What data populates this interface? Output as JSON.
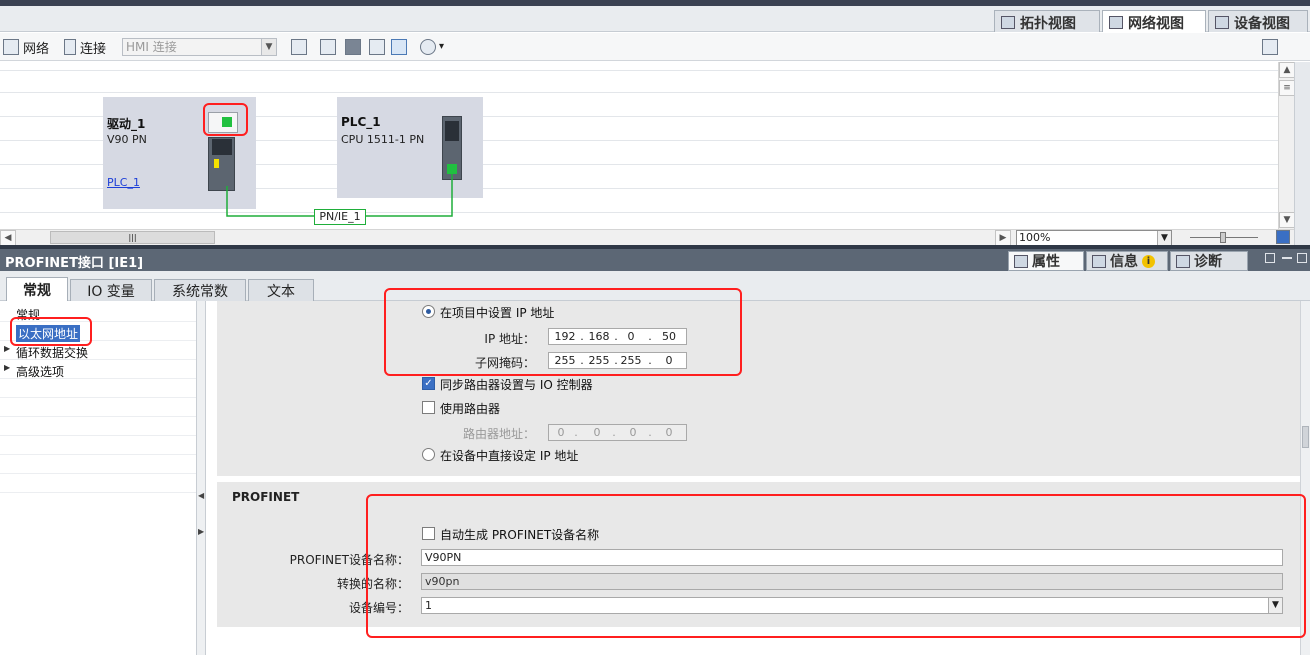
{
  "view_tabs": [
    {
      "label": "拓扑视图",
      "icon": "topology-view-icon"
    },
    {
      "label": "网络视图",
      "icon": "network-view-icon"
    },
    {
      "label": "设备视图",
      "icon": "device-view-icon"
    }
  ],
  "toolbar": {
    "network_label": "网络",
    "connect_label": "连接",
    "connection_type_value": "HMI 连接"
  },
  "canvas": {
    "devices": [
      {
        "name": "驱动_1",
        "type": "V90 PN",
        "assigned_plc": "PLC_1"
      },
      {
        "name": "PLC_1",
        "type": "CPU 1511-1 PN"
      }
    ],
    "subnet_label": "PN/IE_1",
    "zoom_value": "100%"
  },
  "inspector": {
    "title": "PROFINET接口 [IE1]",
    "tabs": [
      {
        "label": "属性",
        "icon": "properties-icon"
      },
      {
        "label": "信息",
        "icon": "info-icon",
        "badge": "i"
      },
      {
        "label": "诊断",
        "icon": "diagnostics-icon"
      }
    ],
    "sub_tabs": [
      "常规",
      "IO 变量",
      "系统常数",
      "文本"
    ],
    "nav": [
      {
        "label": "常规",
        "expandable": false,
        "selected": false
      },
      {
        "label": "以太网地址",
        "expandable": false,
        "selected": true
      },
      {
        "label": "循环数据交换",
        "expandable": true,
        "selected": false
      },
      {
        "label": "高级选项",
        "expandable": true,
        "selected": false
      }
    ]
  },
  "ip_section": {
    "set_in_project_label": "在项目中设置 IP 地址",
    "set_in_project_selected": true,
    "ip_label": "IP 地址：",
    "ip_octets": [
      "192",
      "168",
      "0",
      "50"
    ],
    "mask_label": "子网掩码：",
    "mask_octets": [
      "255",
      "255",
      "255",
      "0"
    ],
    "sync_router_label": "同步路由器设置与 IO 控制器",
    "sync_router_checked": true,
    "use_router_label": "使用路由器",
    "use_router_checked": false,
    "router_label": "路由器地址：",
    "router_octets": [
      "0",
      "0",
      "0",
      "0"
    ],
    "set_on_device_label": "在设备中直接设定 IP 地址",
    "set_on_device_selected": false
  },
  "profinet_section": {
    "heading": "PROFINET",
    "auto_name_label": "自动生成 PROFINET设备名称",
    "auto_name_checked": false,
    "device_name_label": "PROFINET设备名称：",
    "device_name_value": "V90PN",
    "converted_name_label": "转换的名称：",
    "converted_name_value": "v90pn",
    "device_number_label": "设备编号：",
    "device_number_value": "1"
  },
  "colors": {
    "highlight_red": "#ff1f1f",
    "port_green": "#20c040",
    "subnet_green": "#1fae3a",
    "selection_blue": "#3a6fc4",
    "header_gray": "#5c6775"
  }
}
